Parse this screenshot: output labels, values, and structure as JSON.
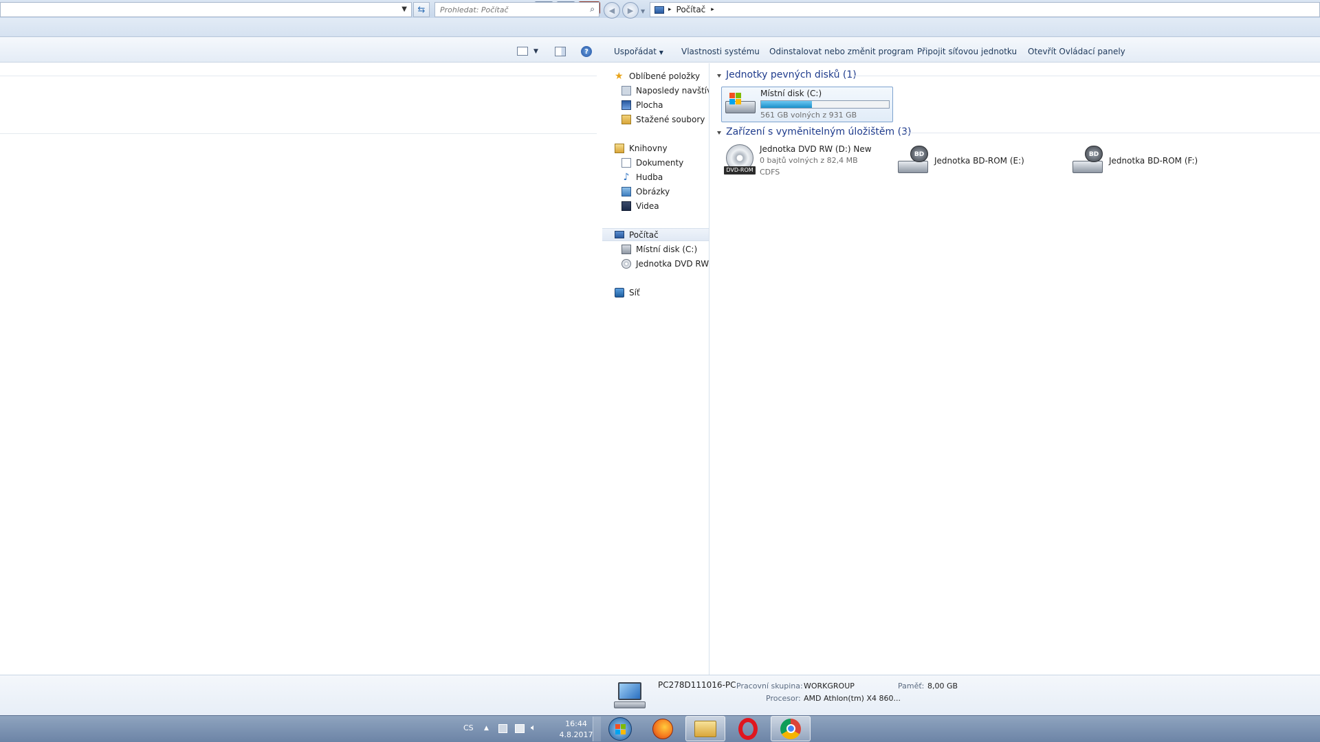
{
  "window": {
    "btn_minimize": "▭",
    "btn_restore": "❐",
    "btn_close": "✕"
  },
  "address": {
    "search_placeholder": "Prohledat: Počítač",
    "path_root": "Počítač"
  },
  "commandbar": {
    "organize": "Uspořádat",
    "system_properties": "Vlastnosti systému",
    "uninstall": "Odinstalovat nebo změnit program",
    "map_drive": "Připojit síťovou jednotku",
    "control_panel": "Otevřít Ovládací panely"
  },
  "navpane": {
    "favorites": "Oblíbené položky",
    "recent": "Naposledy navštívené",
    "desktop": "Plocha",
    "downloads": "Stažené soubory",
    "libraries": "Knihovny",
    "documents": "Dokumenty",
    "music": "Hudba",
    "pictures": "Obrázky",
    "videos": "Videa",
    "computer": "Počítač",
    "local_disk": "Místní disk (C:)",
    "dvd_drive": "Jednotka DVD RW (D:)",
    "network": "Síť"
  },
  "content": {
    "hdd_group": "Jednotky pevných disků (1)",
    "removable_group": "Zařízení s vyměnitelným úložištěm (3)",
    "disk_c": {
      "name": "Místní disk (C:)",
      "free": "561 GB volných z 931 GB",
      "used_fraction": 0.397
    },
    "dvd": {
      "name": "Jednotka DVD RW (D:) New",
      "free": "0 bajtů volných z 82,4 MB",
      "fs": "CDFS",
      "badge": "DVD-ROM"
    },
    "bd_e": {
      "name": "Jednotka BD-ROM (E:)",
      "badge": "BD"
    },
    "bd_f": {
      "name": "Jednotka BD-ROM (F:)",
      "badge": "BD"
    }
  },
  "details": {
    "pc_name": "PC278D111016-PC",
    "workgroup_label": "Pracovní skupina:",
    "workgroup": "WORKGROUP",
    "memory_label": "Paměť:",
    "memory": "8,00 GB",
    "cpu_label": "Procesor:",
    "cpu": "AMD Athlon(tm) X4 860..."
  },
  "taskbar": {
    "language": "CS",
    "time": "16:44",
    "date": "4.8.2017"
  },
  "colors": {
    "accent_blue": "#1e3b8c",
    "progress": "#26a0da"
  }
}
